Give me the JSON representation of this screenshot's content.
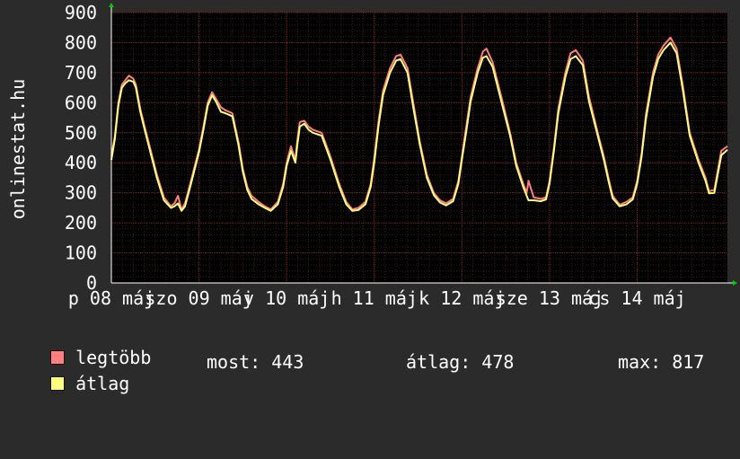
{
  "side_label": "onlinestat.hu",
  "legend": {
    "max_label": "legtöbb",
    "avg_label": "átlag",
    "max_color": "#ff7f7f",
    "avg_color": "#ffff7f"
  },
  "stats": {
    "now_label": "most:",
    "now_value": "443",
    "avg_label": "átlag:",
    "avg_value": "478",
    "max_label": "max:",
    "max_value": "817"
  },
  "chart_data": {
    "type": "line",
    "ylim": [
      0,
      900
    ],
    "y_ticks": [
      0,
      100,
      200,
      300,
      400,
      500,
      600,
      700,
      800,
      900
    ],
    "xlim": [
      0,
      7.03
    ],
    "x_ticks": [
      {
        "x": 0.0,
        "label": "p 08 máj"
      },
      {
        "x": 1.0,
        "label": "szo 09 máj"
      },
      {
        "x": 2.0,
        "label": "v 10 máj"
      },
      {
        "x": 3.0,
        "label": "h 11 máj"
      },
      {
        "x": 4.0,
        "label": "k 12 máj"
      },
      {
        "x": 5.0,
        "label": "sze 13 máj"
      },
      {
        "x": 6.0,
        "label": "cs 14 máj"
      }
    ],
    "grid": true,
    "series": [
      {
        "name": "legtöbb",
        "color": "#ff7f7f",
        "x": [
          0,
          0.04,
          0.08,
          0.12,
          0.16,
          0.2,
          0.25,
          0.28,
          0.33,
          0.38,
          0.45,
          0.52,
          0.6,
          0.68,
          0.72,
          0.76,
          0.8,
          0.84,
          0.9,
          1.0,
          1.05,
          1.1,
          1.15,
          1.2,
          1.25,
          1.3,
          1.38,
          1.45,
          1.5,
          1.55,
          1.6,
          1.68,
          1.75,
          1.82,
          1.9,
          1.96,
          2.0,
          2.05,
          2.1,
          2.12,
          2.15,
          2.2,
          2.25,
          2.3,
          2.4,
          2.5,
          2.6,
          2.68,
          2.75,
          2.82,
          2.9,
          2.96,
          3.0,
          3.05,
          3.1,
          3.18,
          3.25,
          3.3,
          3.38,
          3.45,
          3.52,
          3.6,
          3.68,
          3.75,
          3.82,
          3.9,
          3.96,
          4.0,
          4.05,
          4.1,
          4.18,
          4.24,
          4.28,
          4.35,
          4.45,
          4.55,
          4.62,
          4.7,
          4.74,
          4.76,
          4.82,
          4.9,
          4.96,
          5.0,
          5.05,
          5.1,
          5.18,
          5.24,
          5.3,
          5.38,
          5.45,
          5.55,
          5.62,
          5.68,
          5.72,
          5.8,
          5.88,
          5.95,
          6.0,
          6.05,
          6.1,
          6.18,
          6.24,
          6.3,
          6.38,
          6.45,
          6.52,
          6.6,
          6.7,
          6.78,
          6.82,
          6.88,
          6.96,
          7.03
        ],
        "y": [
          420,
          490,
          600,
          660,
          675,
          690,
          680,
          660,
          580,
          520,
          440,
          360,
          285,
          255,
          265,
          290,
          245,
          265,
          330,
          445,
          520,
          600,
          635,
          610,
          585,
          575,
          565,
          470,
          380,
          320,
          290,
          270,
          255,
          245,
          270,
          330,
          400,
          455,
          410,
          470,
          535,
          540,
          520,
          510,
          500,
          420,
          330,
          270,
          245,
          250,
          270,
          330,
          415,
          540,
          640,
          715,
          755,
          760,
          715,
          590,
          470,
          360,
          300,
          275,
          265,
          280,
          340,
          420,
          520,
          620,
          715,
          770,
          780,
          735,
          620,
          500,
          400,
          330,
          300,
          340,
          285,
          280,
          285,
          340,
          450,
          580,
          700,
          765,
          775,
          740,
          620,
          500,
          420,
          340,
          290,
          260,
          270,
          285,
          340,
          430,
          560,
          700,
          760,
          790,
          817,
          780,
          660,
          500,
          410,
          350,
          305,
          310,
          440,
          455
        ]
      },
      {
        "name": "átlag",
        "color": "#ffff7f",
        "x": [
          0,
          0.04,
          0.08,
          0.12,
          0.16,
          0.2,
          0.25,
          0.28,
          0.33,
          0.38,
          0.45,
          0.52,
          0.6,
          0.68,
          0.72,
          0.76,
          0.8,
          0.84,
          0.9,
          1.0,
          1.05,
          1.1,
          1.15,
          1.2,
          1.25,
          1.3,
          1.38,
          1.45,
          1.5,
          1.55,
          1.6,
          1.68,
          1.75,
          1.82,
          1.9,
          1.96,
          2.0,
          2.05,
          2.1,
          2.12,
          2.15,
          2.2,
          2.25,
          2.3,
          2.4,
          2.5,
          2.6,
          2.68,
          2.75,
          2.82,
          2.9,
          2.96,
          3.0,
          3.05,
          3.1,
          3.18,
          3.25,
          3.3,
          3.38,
          3.45,
          3.52,
          3.6,
          3.68,
          3.75,
          3.82,
          3.9,
          3.96,
          4.0,
          4.05,
          4.1,
          4.18,
          4.24,
          4.28,
          4.35,
          4.45,
          4.55,
          4.62,
          4.7,
          4.74,
          4.76,
          4.82,
          4.9,
          4.96,
          5.0,
          5.05,
          5.1,
          5.18,
          5.24,
          5.3,
          5.38,
          5.45,
          5.55,
          5.62,
          5.68,
          5.72,
          5.8,
          5.88,
          5.95,
          6.0,
          6.05,
          6.1,
          6.18,
          6.24,
          6.3,
          6.38,
          6.45,
          6.52,
          6.6,
          6.7,
          6.78,
          6.82,
          6.88,
          6.96,
          7.03
        ],
        "y": [
          410,
          480,
          590,
          650,
          665,
          675,
          670,
          650,
          570,
          510,
          430,
          350,
          275,
          250,
          255,
          265,
          240,
          255,
          320,
          435,
          510,
          590,
          625,
          600,
          570,
          565,
          555,
          460,
          370,
          310,
          280,
          262,
          250,
          240,
          262,
          320,
          390,
          440,
          400,
          455,
          520,
          530,
          510,
          500,
          490,
          410,
          320,
          262,
          240,
          243,
          262,
          320,
          400,
          525,
          625,
          700,
          740,
          745,
          700,
          575,
          460,
          350,
          292,
          268,
          258,
          272,
          330,
          410,
          505,
          605,
          700,
          750,
          755,
          720,
          605,
          490,
          390,
          320,
          290,
          275,
          275,
          272,
          278,
          330,
          440,
          565,
          685,
          745,
          755,
          725,
          605,
          490,
          410,
          330,
          282,
          255,
          262,
          278,
          330,
          420,
          545,
          685,
          745,
          775,
          800,
          765,
          645,
          490,
          400,
          340,
          298,
          300,
          425,
          443
        ]
      }
    ]
  }
}
